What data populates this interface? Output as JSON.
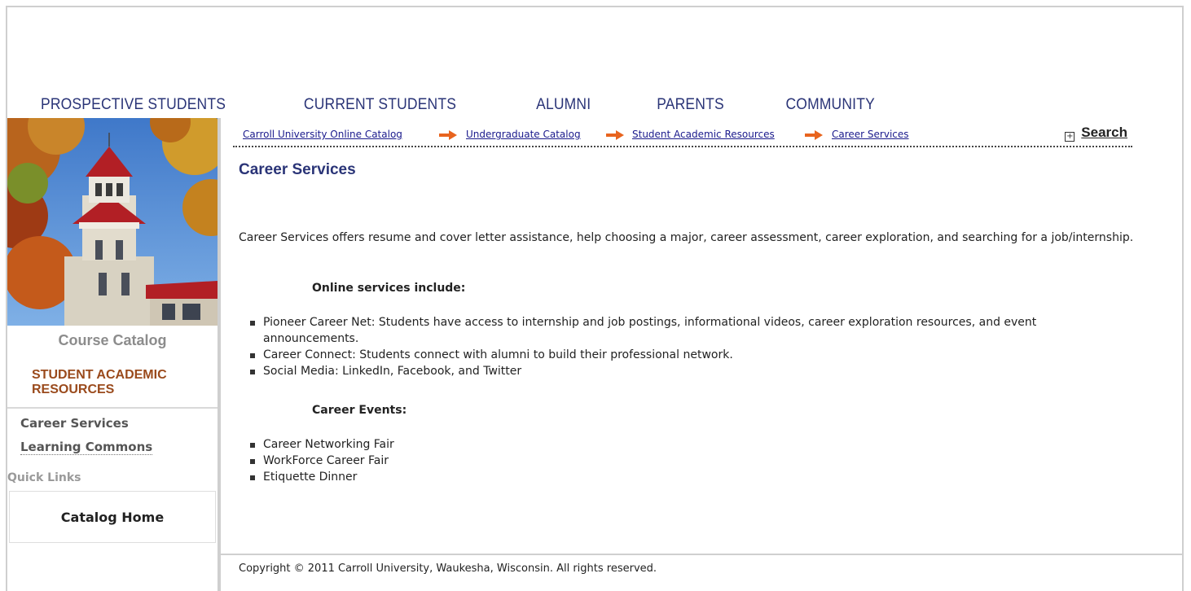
{
  "top_nav": {
    "items": [
      "PROSPECTIVE STUDENTS",
      "CURRENT STUDENTS",
      "ALUMNI",
      "PARENTS",
      "COMMUNITY"
    ]
  },
  "sidebar": {
    "catalog_label": "Course Catalog",
    "section_heading": "STUDENT ACADEMIC RESOURCES",
    "links": [
      "Career Services",
      "Learning Commons"
    ],
    "quick_links_label": "Quick Links",
    "catalog_home": "Catalog Home"
  },
  "breadcrumb": {
    "items": [
      "Carroll University Online Catalog",
      "Undergraduate Catalog",
      "Student Academic Resources",
      "Career Services"
    ],
    "search_label": "Search"
  },
  "page": {
    "title": "Career Services",
    "intro": "Career Services offers resume and cover letter assistance, help choosing a major, career assessment, career exploration, and searching for a job/internship.",
    "online_heading": "Online services include:",
    "online_items": [
      "Pioneer Career Net: Students have access to internship and job postings, informational videos, career exploration resources, and event announcements.",
      "Career Connect: Students connect with alumni to build their professional network.",
      "Social Media: LinkedIn, Facebook, and Twitter"
    ],
    "events_heading": "Career Events:",
    "event_items": [
      "Career Networking Fair",
      "WorkForce Career Fair",
      "Etiquette Dinner"
    ]
  },
  "footer": {
    "copyright": "Copyright © 2011 Carroll University, Waukesha, Wisconsin. All rights reserved."
  },
  "colors": {
    "nav_text": "#2a3477",
    "section_heading": "#9a4a1c",
    "link": "#1a1a8c",
    "arrow": "#e8641e"
  }
}
